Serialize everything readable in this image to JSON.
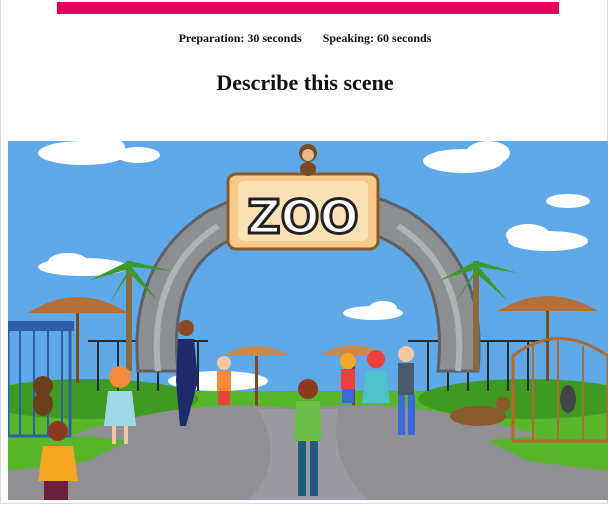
{
  "task": {
    "preparation": "Preparation: 30 seconds",
    "speaking": "Speaking: 60 seconds",
    "title": "Describe this scene"
  },
  "scene": {
    "sign_text": "ZOO",
    "colors": {
      "accent": "#e6005f",
      "sky": "#5fa9e8",
      "grass": "#58b62a",
      "path": "#8f8f94",
      "arch": "#8d8f93",
      "sign": "#f7c98b"
    }
  }
}
